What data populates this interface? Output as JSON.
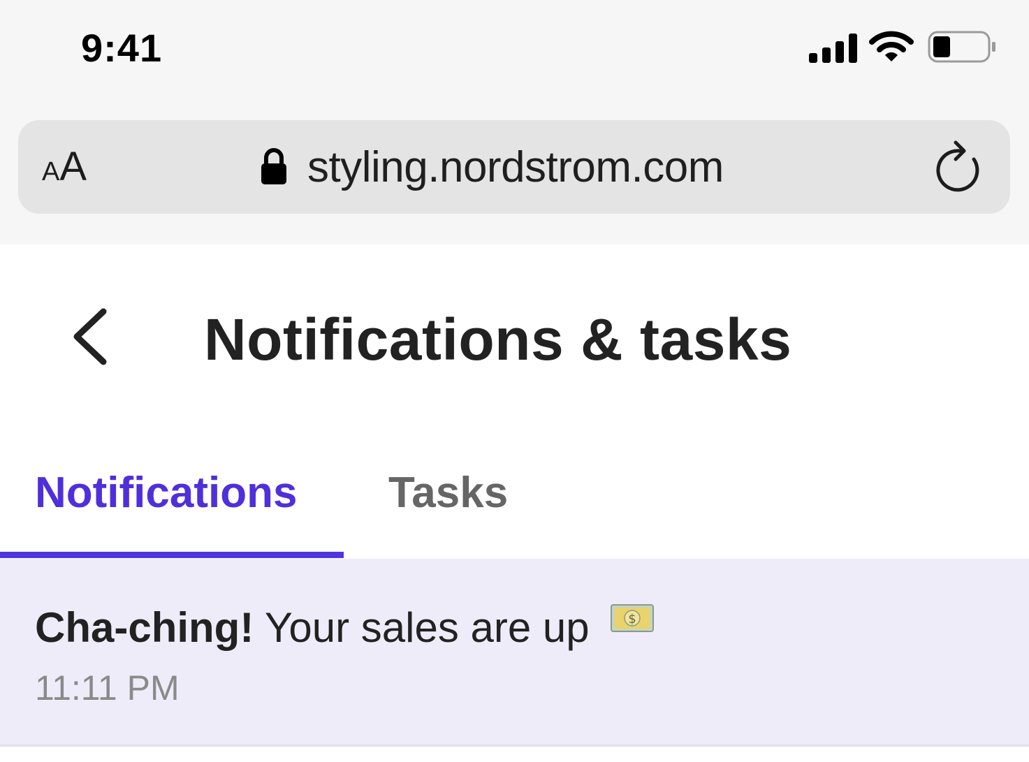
{
  "status_bar": {
    "time": "9:41",
    "icons": [
      "cellular-signal-icon",
      "wifi-icon",
      "battery-icon"
    ]
  },
  "browser": {
    "text_size_label_small": "A",
    "text_size_label_large": "A",
    "url": "styling.nordstrom.com",
    "icons": [
      "lock-icon",
      "reload-icon"
    ]
  },
  "header": {
    "title": "Notifications & tasks",
    "back_icon": "chevron-left-icon"
  },
  "tabs": [
    {
      "label": "Notifications",
      "active": true
    },
    {
      "label": "Tasks",
      "active": false
    }
  ],
  "notifications": [
    {
      "title_bold": "Cha-ching!",
      "message": " Your sales are up",
      "emoji_icon": "money-bill-icon",
      "time": "11:11 PM"
    }
  ],
  "colors": {
    "accent": "#4f35e0",
    "notification_bg": "#efecfa",
    "chrome_bg": "#f6f6f6",
    "urlbar_bg": "#e4e4e4"
  }
}
